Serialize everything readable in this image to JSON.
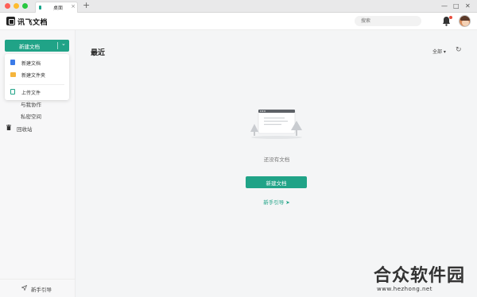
{
  "window": {
    "tab_label": "桌面",
    "tab_close": "×",
    "tab_add": "+",
    "controls": [
      "—",
      "□",
      "✕"
    ]
  },
  "header": {
    "app_name": "讯飞文档",
    "search_placeholder": "搜索",
    "notification_icon": "bell-icon",
    "avatar_icon": "user-avatar"
  },
  "sidebar": {
    "new_button_label": "新建文档",
    "new_button_caret": "⌄",
    "dropdown": {
      "items": [
        {
          "label": "新建文档",
          "icon": "document-icon",
          "color": "#3b7be8"
        },
        {
          "label": "新建文件夹",
          "icon": "folder-icon",
          "color": "#f5b53d"
        },
        {
          "label": "上传文件",
          "icon": "upload-icon",
          "color": "#20a387"
        }
      ]
    },
    "links": [
      {
        "label": "与我协作"
      },
      {
        "label": "私密空间"
      },
      {
        "label": "回收站",
        "icon": "trash-icon"
      }
    ],
    "guide_label": "新手引导"
  },
  "main": {
    "title": "最近",
    "filter_label": "全部 ▾",
    "refresh_icon": "↻",
    "empty_text": "还没有文档",
    "cta_label": "新建文档",
    "guide_label": "新手引导 ➤"
  },
  "watermark": {
    "text": "合众软件园",
    "url": "www.hezhong.net"
  },
  "colors": {
    "accent": "#20a387",
    "traffic_red": "#fe5f57",
    "traffic_yellow": "#febc2e",
    "traffic_green": "#28c840"
  }
}
